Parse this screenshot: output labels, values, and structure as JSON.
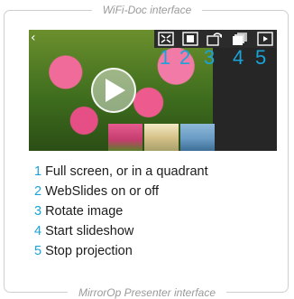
{
  "captions": {
    "top": "WiFi-Doc interface",
    "bottom": "MirrorOp Presenter interface"
  },
  "screen": {
    "back_icon": "chevron-left-icon",
    "play_icon": "play-icon"
  },
  "toolbar": {
    "buttons": [
      {
        "number": "1",
        "icon": "fullscreen-quadrant-icon"
      },
      {
        "number": "2",
        "icon": "webslides-icon"
      },
      {
        "number": "3",
        "icon": "rotate-image-icon"
      },
      {
        "number": "4",
        "icon": "slideshow-icon"
      },
      {
        "number": "5",
        "icon": "stop-projection-icon"
      }
    ]
  },
  "legend": [
    {
      "number": "1",
      "text": "Full screen, or in a quadrant"
    },
    {
      "number": "2",
      "text": "WebSlides on or off"
    },
    {
      "number": "3",
      "text": "Rotate image"
    },
    {
      "number": "4",
      "text": "Start slideshow"
    },
    {
      "number": "5",
      "text": "Stop projection"
    }
  ],
  "colors": {
    "accent": "#1aa3d9",
    "toolbar": "#2b2b2b",
    "frame": "#cfcfcf",
    "caption": "#9a9a9a"
  }
}
